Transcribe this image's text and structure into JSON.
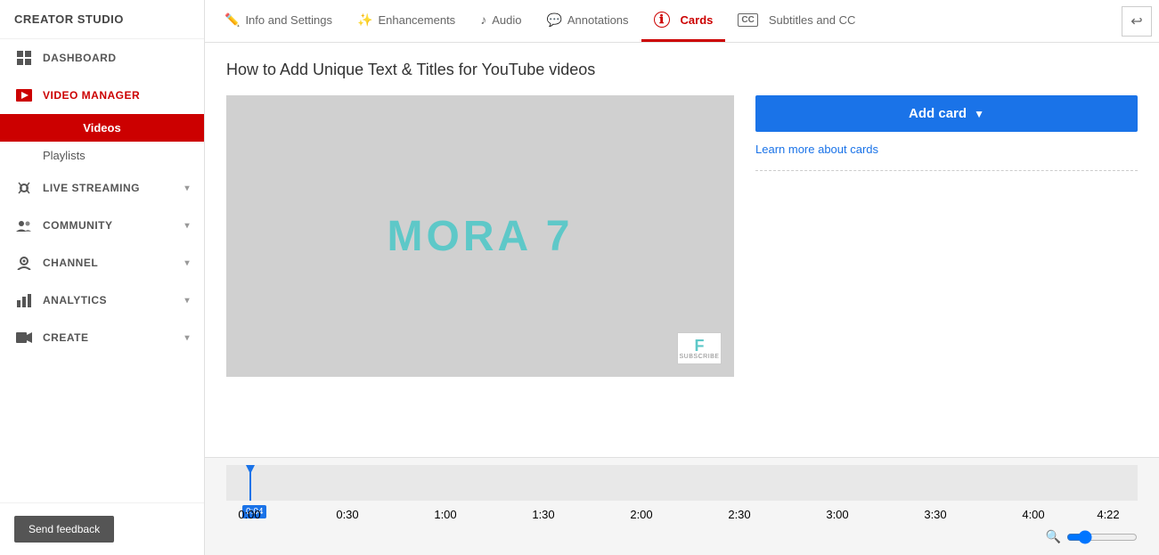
{
  "app": {
    "name": "CREATOR STUDIO"
  },
  "sidebar": {
    "logo": "CREATOR STUDIO",
    "items": [
      {
        "id": "dashboard",
        "label": "DASHBOARD",
        "icon": "grid",
        "active": false,
        "hasChevron": false
      },
      {
        "id": "video-manager",
        "label": "VIDEO MANAGER",
        "icon": "video",
        "active": true,
        "hasChevron": false
      },
      {
        "id": "videos",
        "label": "Videos",
        "subItem": true,
        "active": true
      },
      {
        "id": "playlists",
        "label": "Playlists",
        "subItem": true,
        "active": false
      },
      {
        "id": "live-streaming",
        "label": "LIVE STREAMING",
        "icon": "broadcast",
        "active": false,
        "hasChevron": true
      },
      {
        "id": "community",
        "label": "COMMUNITY",
        "icon": "people",
        "active": false,
        "hasChevron": true
      },
      {
        "id": "channel",
        "label": "CHANNEL",
        "icon": "person-circle",
        "active": false,
        "hasChevron": true
      },
      {
        "id": "analytics",
        "label": "ANALYTICS",
        "icon": "bar-chart",
        "active": false,
        "hasChevron": true
      },
      {
        "id": "create",
        "label": "CREATE",
        "icon": "camera",
        "active": false,
        "hasChevron": true
      }
    ],
    "feedback_label": "Send feedback"
  },
  "tabs": [
    {
      "id": "info-settings",
      "label": "Info and Settings",
      "icon": "✏️",
      "active": false
    },
    {
      "id": "enhancements",
      "label": "Enhancements",
      "icon": "✨",
      "active": false
    },
    {
      "id": "audio",
      "label": "Audio",
      "icon": "♪",
      "active": false
    },
    {
      "id": "annotations",
      "label": "Annotations",
      "icon": "💬",
      "active": false
    },
    {
      "id": "cards",
      "label": "Cards",
      "icon": "ℹ",
      "active": true
    },
    {
      "id": "subtitles-cc",
      "label": "Subtitles and CC",
      "icon": "CC",
      "active": false
    }
  ],
  "video": {
    "title": "How to Add Unique Text & Titles for YouTube videos",
    "player_text": "MORA 7",
    "subscribe_label": "SUBSCRIBE"
  },
  "cards_panel": {
    "add_card_label": "Add card",
    "learn_more_label": "Learn more about cards"
  },
  "timeline": {
    "current_time": "0:04",
    "marks": [
      "0:00",
      "0:30",
      "1:00",
      "1:30",
      "2:00",
      "2:30",
      "3:00",
      "3:30",
      "4:00",
      "4:22"
    ]
  }
}
